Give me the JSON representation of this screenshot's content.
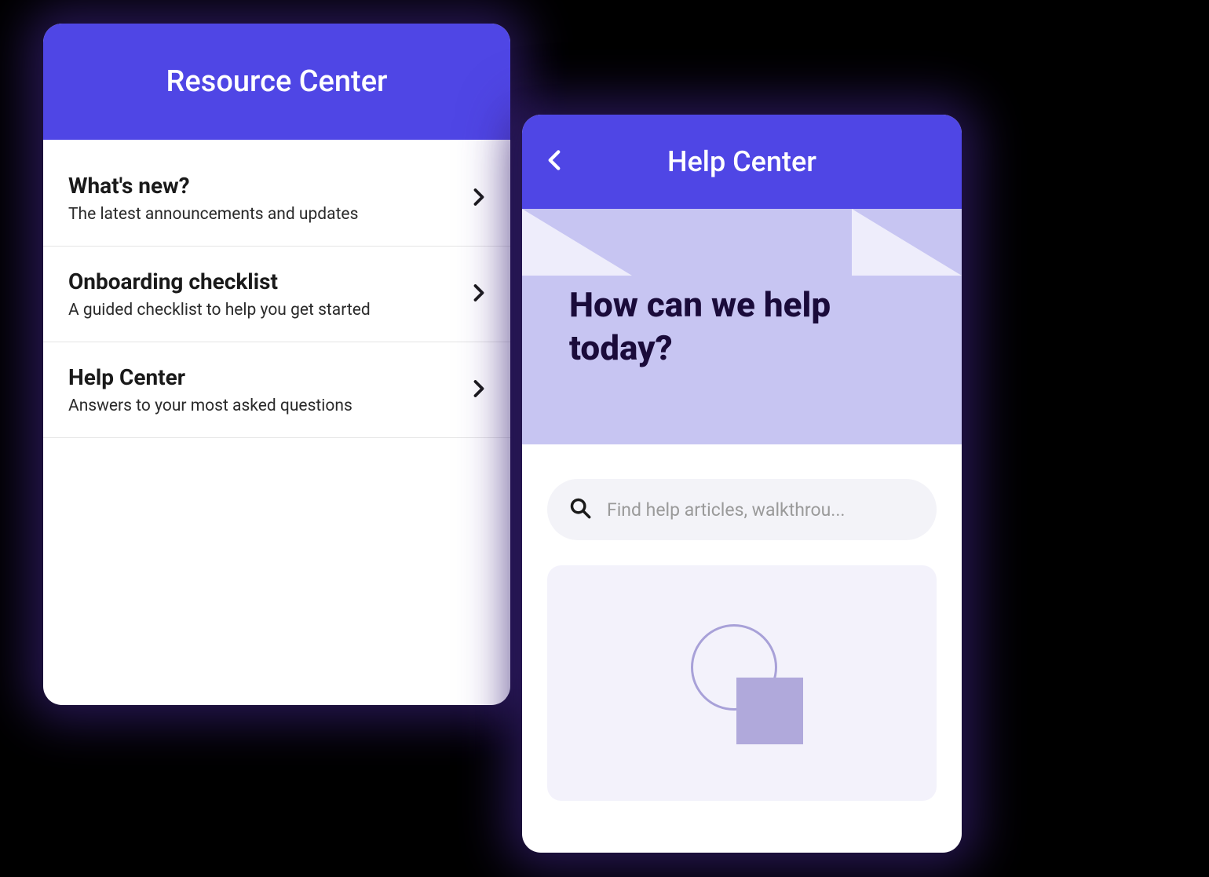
{
  "resource_center": {
    "title": "Resource Center",
    "items": [
      {
        "title": "What's new?",
        "desc": "The latest announcements and updates"
      },
      {
        "title": "Onboarding checklist",
        "desc": "A guided checklist to help you get started"
      },
      {
        "title": "Help Center",
        "desc": "Answers to your most asked questions"
      }
    ]
  },
  "help_center": {
    "title": "Help Center",
    "hero_title": "How can we help today?",
    "search_placeholder": "Find help articles, walkthrou..."
  }
}
